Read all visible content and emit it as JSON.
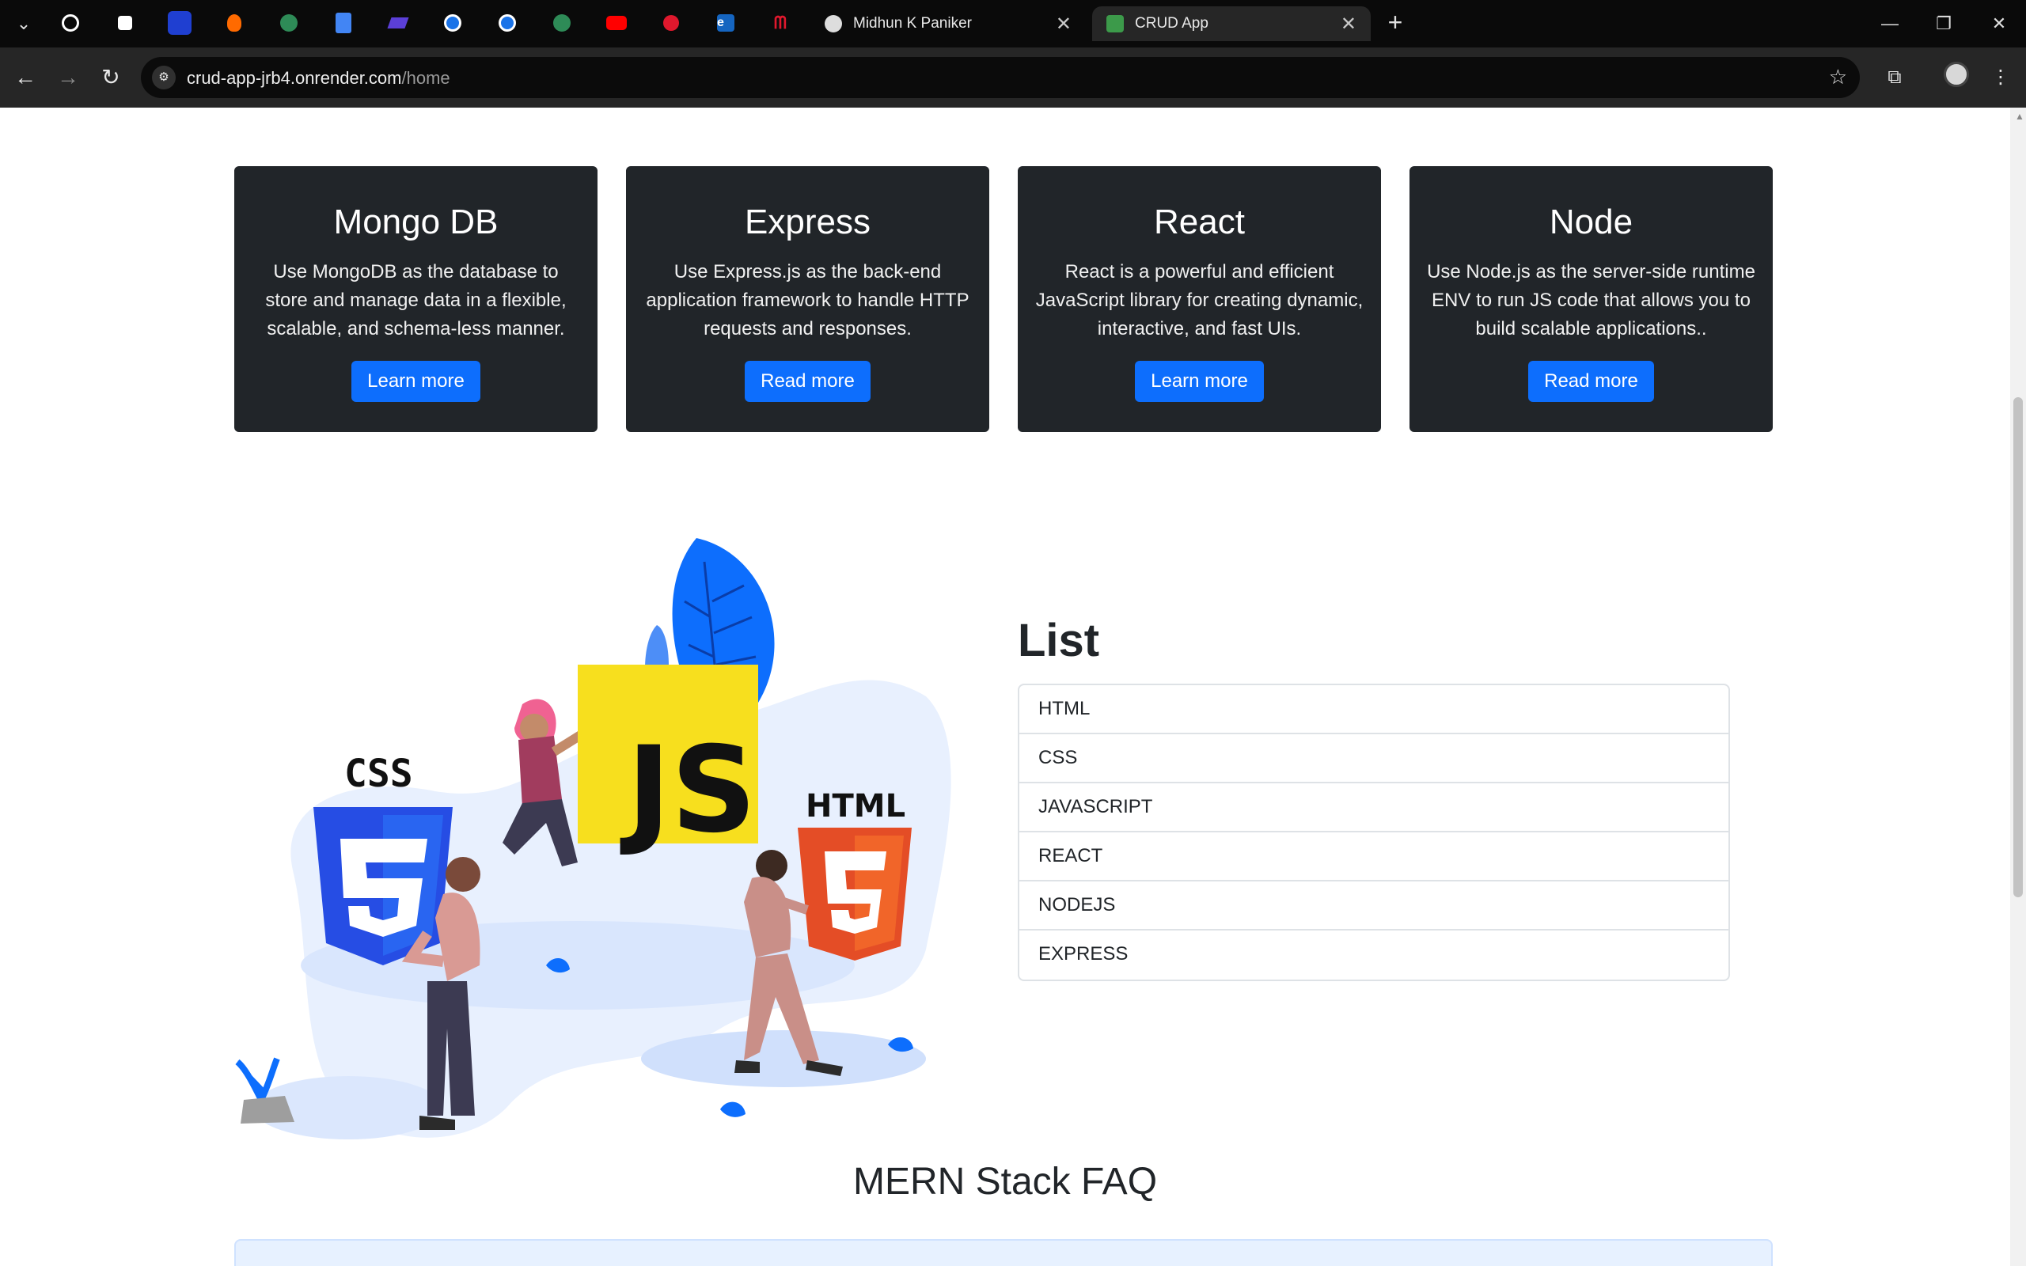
{
  "browser": {
    "tabs": [
      {
        "title": "Midhun K Paniker",
        "active": false
      },
      {
        "title": "CRUD App",
        "active": true
      }
    ],
    "pinned_tabs": [
      "openai-icon",
      "extension-icon",
      "dashboard-icon",
      "firefox-icon",
      "globe-icon",
      "docs-icon",
      "app-icon",
      "play-icon",
      "play-icon",
      "globe-icon",
      "youtube-icon",
      "app-icon",
      "edge-icon",
      "app-icon"
    ],
    "url_host": "crud-app-jrb4.onrender.com",
    "url_path": "/home"
  },
  "cards": [
    {
      "title": "Mongo DB",
      "text": "Use MongoDB as the database to store and manage data in a flexible, scalable, and schema-less manner.",
      "button": "Learn more"
    },
    {
      "title": "Express",
      "text": "Use Express.js as the back-end application framework to handle HTTP requests and responses.",
      "button": "Read more"
    },
    {
      "title": "React",
      "text": "React is a powerful and efficient JavaScript library for creating dynamic, interactive, and fast UIs.",
      "button": "Learn more"
    },
    {
      "title": "Node",
      "text": "Use Node.js as the server-side runtime ENV to run JS code that allows you to build scalable applications..",
      "button": "Read more"
    }
  ],
  "illustration": {
    "css_label": "CSS",
    "js_label": "JS",
    "html_label": "HTML"
  },
  "list": {
    "heading": "List",
    "items": [
      "HTML",
      "CSS",
      "JAVASCRIPT",
      "REACT",
      "NODEJS",
      "EXPRESS"
    ]
  },
  "faq": {
    "title": "MERN Stack FAQ"
  },
  "colors": {
    "card_bg": "#212529",
    "button": "#0d6efd",
    "css_blue": "#264de4",
    "js_yellow": "#f7df1e",
    "html_orange": "#e44d26"
  }
}
